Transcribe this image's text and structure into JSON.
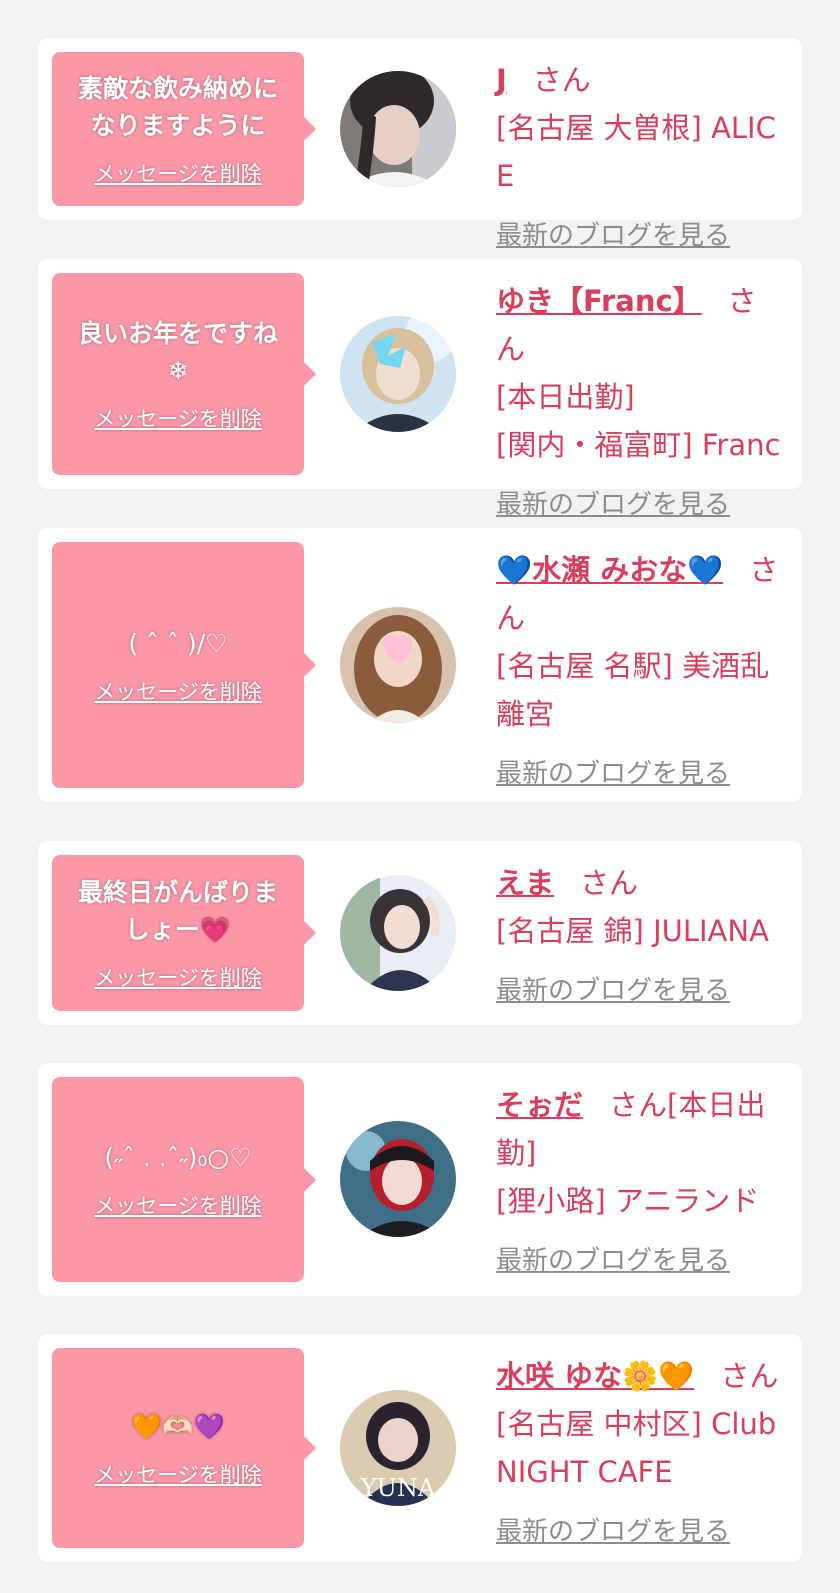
{
  "cards": [
    {
      "message": "素敵な飲み納めに\nなりますように",
      "delete_label": "メッセージを削除",
      "name": "J",
      "san": "さん",
      "lines": [
        "[名古屋 大曽根] ALICE"
      ],
      "blog_label": "最新のブログを見る"
    },
    {
      "message": "良いお年をですね\n❄",
      "delete_label": "メッセージを削除",
      "name": "ゆき【Franc】",
      "san": "さん",
      "lines": [
        "[本日出勤]",
        "[関内・福富町] Franc"
      ],
      "blog_label": "最新のブログを見る"
    },
    {
      "message": "( ˆ ˆ )/♡",
      "delete_label": "メッセージを削除",
      "name": "💙水瀬 みおな💙",
      "san": "さん",
      "lines": [
        "[名古屋 名駅] 美酒乱離宮"
      ],
      "blog_label": "最新のブログを見る"
    },
    {
      "message": "最終日がんばりま\nしょー💗",
      "delete_label": "メッセージを削除",
      "name": "えま",
      "san": "さん",
      "lines": [
        "[名古屋 錦] JULIANA"
      ],
      "blog_label": "最新のブログを見る"
    },
    {
      "message": "(˶ˆ . .ˆ˶)₀○♡",
      "delete_label": "メッセージを削除",
      "name": "そぉだ",
      "san": "さん[本日出勤]",
      "lines": [
        "[狸小路] アニランド"
      ],
      "blog_label": "最新のブログを見る"
    },
    {
      "message": "🧡🫶🏻💜",
      "delete_label": "メッセージを削除",
      "name": "水咲 ゆな🌼🧡",
      "san": "さん",
      "lines": [
        "[名古屋 中村区] Club NIGHT CAFE"
      ],
      "blog_label": "最新のブログを見る"
    }
  ],
  "avatar_6_text": "YUNA",
  "colors": {
    "background": "#f2f2f2",
    "bubble": "#fc97a8",
    "accent_text": "#d93f5c",
    "link_gray": "#8c8c8c"
  }
}
